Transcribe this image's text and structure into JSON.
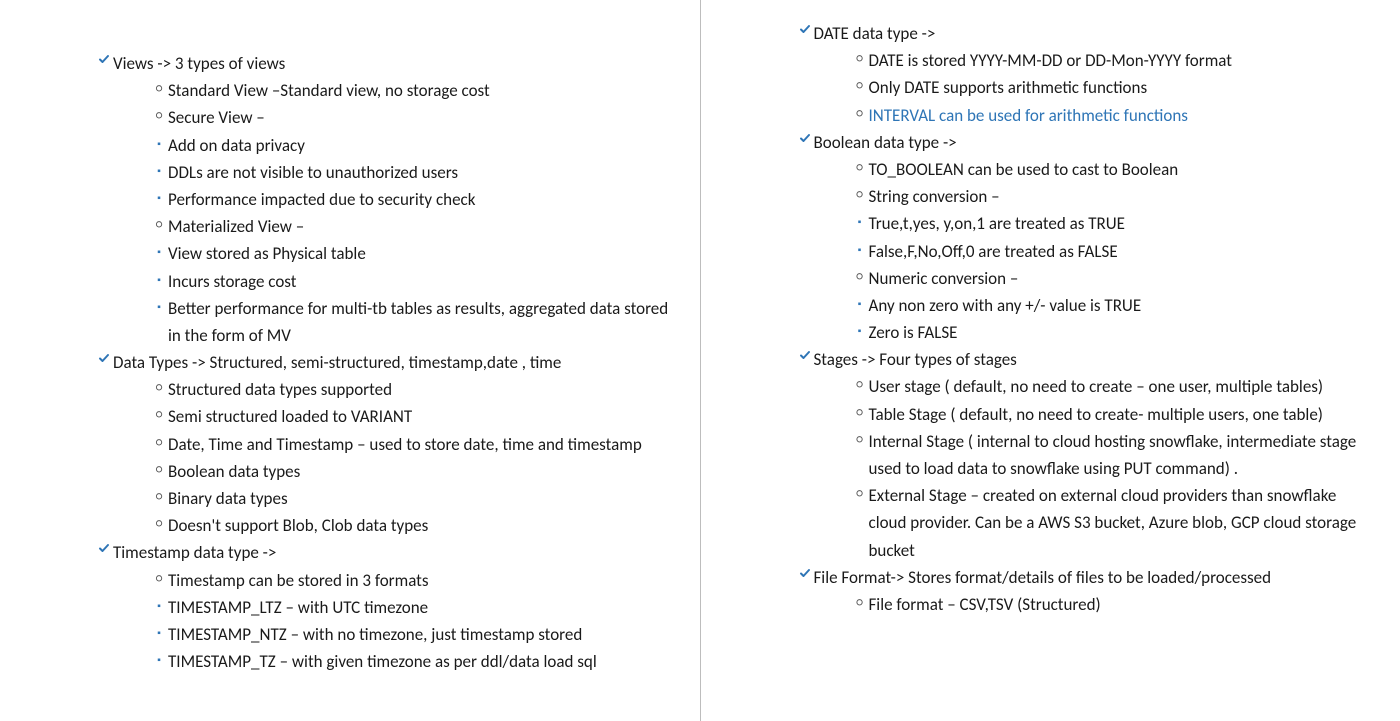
{
  "left": [
    {
      "type": "check",
      "text": "Views ->  3 types of views"
    },
    {
      "type": "circ",
      "text": "Standard View –Standard view, no storage cost"
    },
    {
      "type": "circ",
      "text": "Secure View –"
    },
    {
      "type": "sq",
      "text": "Add on data privacy"
    },
    {
      "type": "sq",
      "text": "DDLs are not visible to unauthorized users"
    },
    {
      "type": "sq",
      "text": "Performance impacted due to security check"
    },
    {
      "type": "circ",
      "text": "Materialized View –"
    },
    {
      "type": "sq",
      "text": "View stored as Physical table"
    },
    {
      "type": "sq",
      "text": "Incurs storage cost"
    },
    {
      "type": "sq",
      "text": "Better performance for multi-tb tables as results, aggregated data stored in the form of MV"
    },
    {
      "type": "check",
      "text": "Data Types -> Structured, semi-structured, timestamp,date , time"
    },
    {
      "type": "circ",
      "text": "Structured data types supported"
    },
    {
      "type": "circ",
      "text": "Semi structured loaded to VARIANT"
    },
    {
      "type": "circ",
      "text": "Date, Time and Timestamp – used to store date, time and timestamp"
    },
    {
      "type": "circ",
      "text": "Boolean data types"
    },
    {
      "type": "circ",
      "text": "Binary data types"
    },
    {
      "type": "circ",
      "text": "Doesn't support Blob, Clob data types"
    },
    {
      "type": "check",
      "text": "Timestamp data type ->"
    },
    {
      "type": "circ",
      "text": "Timestamp can be stored in 3 formats"
    },
    {
      "type": "sq",
      "text": "TIMESTAMP_LTZ – with UTC timezone"
    },
    {
      "type": "sq",
      "text": "TIMESTAMP_NTZ – with no timezone, just timestamp stored"
    },
    {
      "type": "sq",
      "text": "TIMESTAMP_TZ – with given timezone as per ddl/data load sql"
    }
  ],
  "right": [
    {
      "type": "check",
      "text": "DATE data type ->"
    },
    {
      "type": "circ",
      "text": "DATE is stored YYYY-MM-DD or DD-Mon-YYYY format"
    },
    {
      "type": "circ",
      "text": "Only DATE supports arithmetic functions"
    },
    {
      "type": "circ",
      "text": "INTERVAL can be used for arithmetic functions",
      "link": true
    },
    {
      "type": "check",
      "text": "Boolean data type ->"
    },
    {
      "type": "circ",
      "text": "TO_BOOLEAN can be used to cast to Boolean"
    },
    {
      "type": "circ",
      "text": "String conversion –"
    },
    {
      "type": "sq",
      "text": "True,t,yes, y,on,1 are treated as TRUE"
    },
    {
      "type": "sq",
      "text": "False,F,No,Off,0 are treated as FALSE"
    },
    {
      "type": "circ",
      "text": "Numeric conversion –"
    },
    {
      "type": "sq",
      "text": "Any non zero with any +/- value is TRUE"
    },
    {
      "type": "sq",
      "text": "Zero is FALSE"
    },
    {
      "type": "check",
      "text": "Stages -> Four types of stages"
    },
    {
      "type": "circ",
      "text": "User stage ( default, no need to create – one user, multiple tables)"
    },
    {
      "type": "circ",
      "text": "Table Stage ( default, no need to create- multiple users, one table)"
    },
    {
      "type": "circ",
      "text": "Internal Stage ( internal to cloud hosting snowflake, intermediate stage used to load data to snowflake using PUT command) ."
    },
    {
      "type": "circ",
      "text": "External Stage – created on external cloud providers than snowflake cloud provider. Can be a AWS S3 bucket, Azure blob, GCP cloud storage bucket"
    },
    {
      "type": "check",
      "text": "File Format-> Stores format/details of files to be loaded/processed"
    },
    {
      "type": "circ",
      "text": "File format – CSV,TSV (Structured)"
    }
  ]
}
